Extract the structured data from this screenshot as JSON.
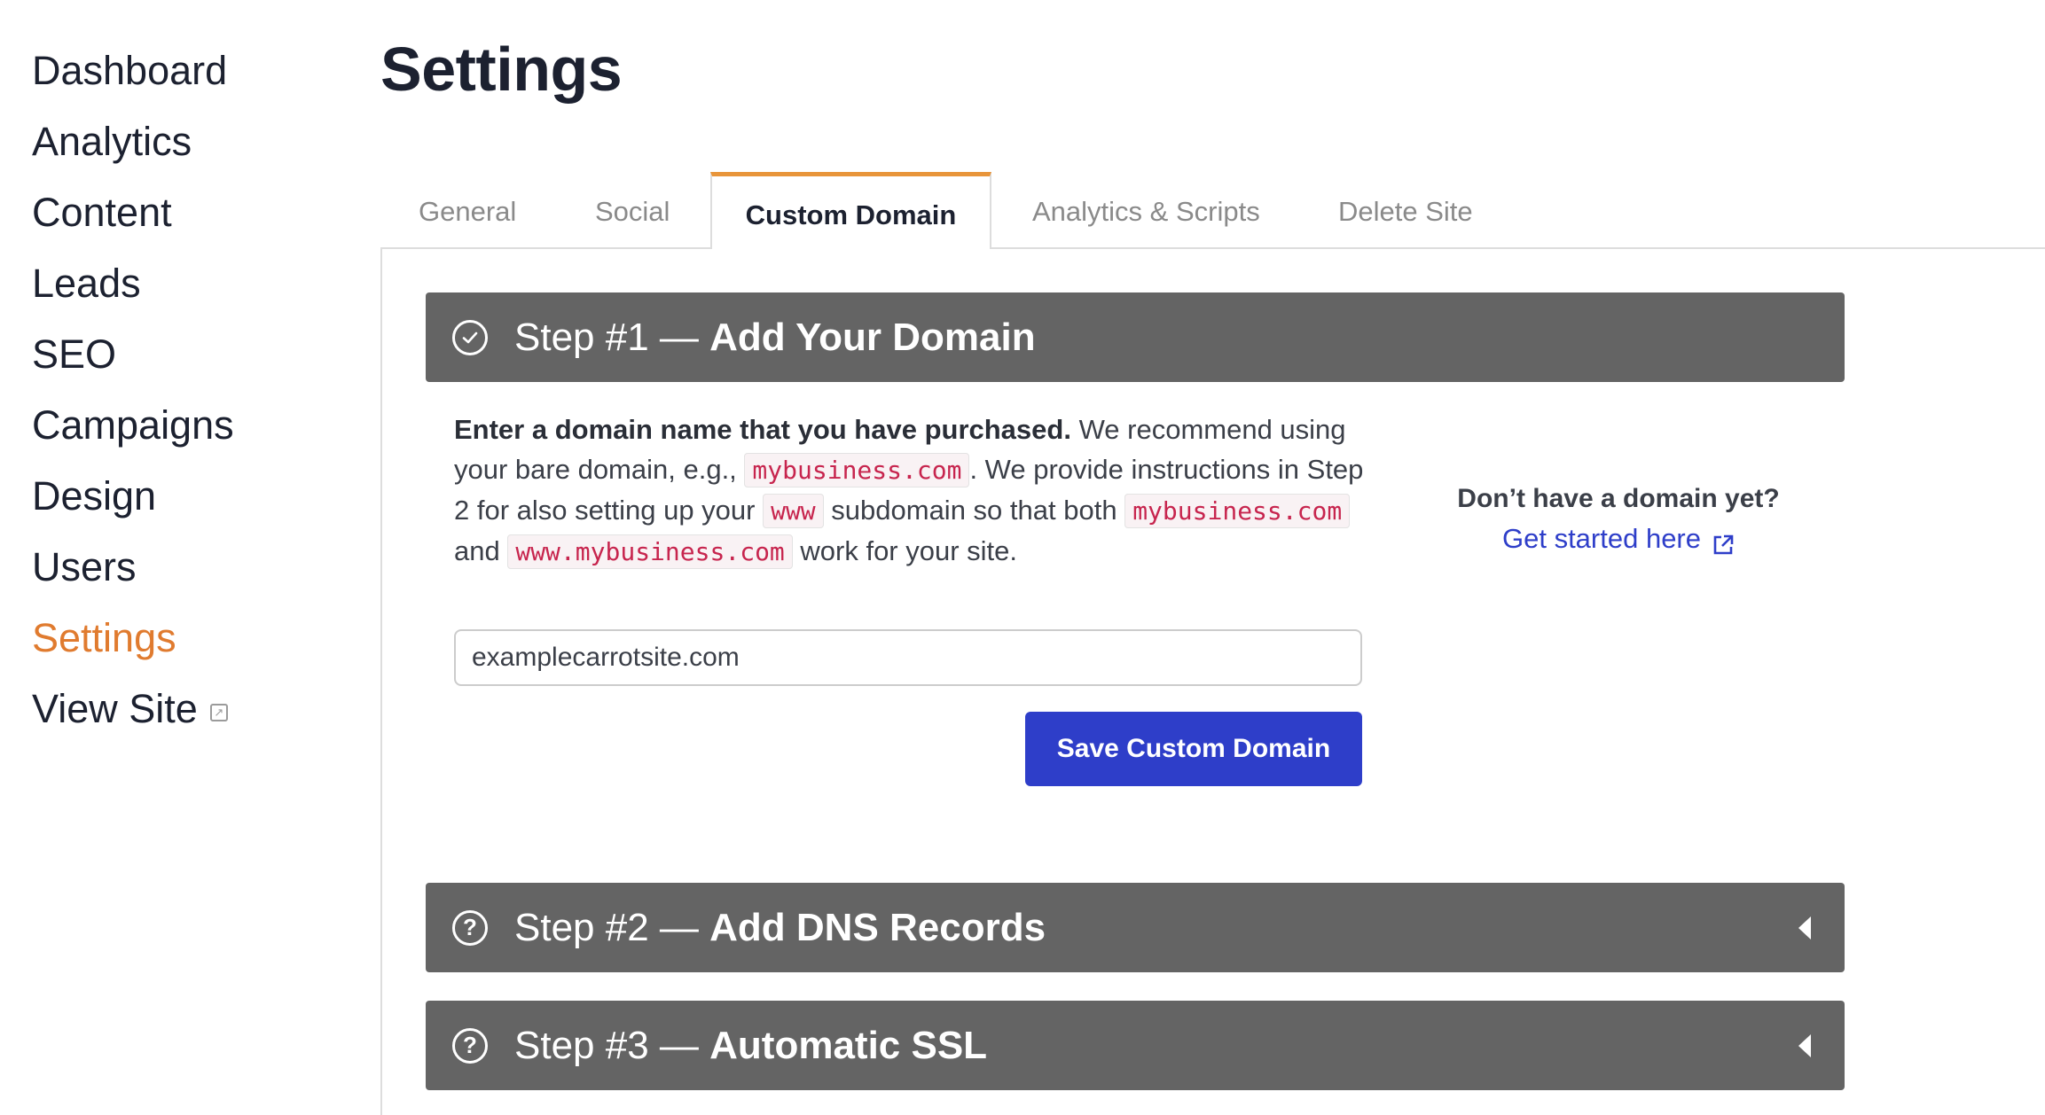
{
  "sidebar": {
    "items": [
      {
        "label": "Dashboard"
      },
      {
        "label": "Analytics"
      },
      {
        "label": "Content"
      },
      {
        "label": "Leads"
      },
      {
        "label": "SEO"
      },
      {
        "label": "Campaigns"
      },
      {
        "label": "Design"
      },
      {
        "label": "Users"
      },
      {
        "label": "Settings",
        "active": true
      },
      {
        "label": "View Site",
        "icon": "external-link-icon"
      }
    ]
  },
  "page": {
    "title": "Settings"
  },
  "tabs": {
    "general": "General",
    "social": "Social",
    "custom_domain": "Custom Domain",
    "analytics_scripts": "Analytics & Scripts",
    "delete_site": "Delete Site",
    "active": "Custom Domain"
  },
  "step1": {
    "prefix": "Step #1 — ",
    "title": "Add Your Domain",
    "icon": "check-circle-icon",
    "intro_bold": "Enter a domain name that you have purchased.",
    "text1": " We recommend using your bare domain, e.g., ",
    "code1": "mybusiness.com",
    "text2": ". We provide instructions in Step 2 for also setting up your ",
    "code2": "www",
    "text3": " subdomain so that both ",
    "code3": "mybusiness.com",
    "text4": " and ",
    "code4": "www.mybusiness.com",
    "text5": " work for your site.",
    "input_value": "examplecarrotsite.com",
    "save_label": "Save Custom Domain",
    "aside_title": "Don’t have a domain yet?",
    "aside_link": "Get started here"
  },
  "step2": {
    "prefix": "Step #2 — ",
    "title": "Add DNS Records",
    "icon": "question-circle-icon",
    "state": "collapsed"
  },
  "step3": {
    "prefix": "Step #3 — ",
    "title": "Automatic SSL",
    "icon": "question-circle-icon",
    "state": "collapsed"
  },
  "colors": {
    "accent_orange": "#e07b2f",
    "tab_indicator": "#e8953a",
    "step_header_bg": "#646464",
    "primary_button": "#2e3ec9",
    "code_text": "#c7254e"
  }
}
